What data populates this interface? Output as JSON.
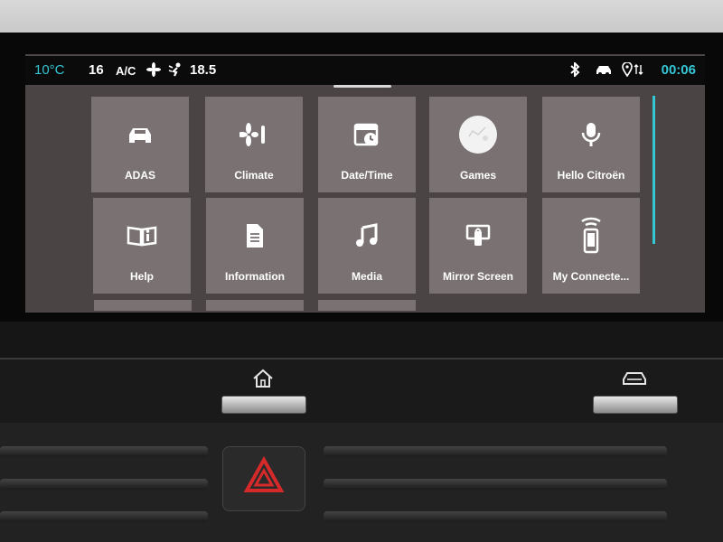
{
  "status": {
    "ext_temp": "10°C",
    "cabin_temp_left": "16",
    "ac": "A/C",
    "cabin_temp_right": "18.5",
    "time": "00:06"
  },
  "apps": [
    {
      "label": "ADAS",
      "icon": "car-icon"
    },
    {
      "label": "Climate",
      "icon": "fan-icon"
    },
    {
      "label": "Date/Time",
      "icon": "calendar-clock-icon"
    },
    {
      "label": "Games",
      "icon": "games-icon"
    },
    {
      "label": "Hello Citroën",
      "icon": "microphone-icon"
    },
    {
      "label": "Help",
      "icon": "book-info-icon"
    },
    {
      "label": "Information",
      "icon": "document-icon"
    },
    {
      "label": "Media",
      "icon": "music-note-icon"
    },
    {
      "label": "Mirror Screen",
      "icon": "mirror-screen-icon"
    },
    {
      "label": "My Connecte...",
      "icon": "connected-phone-icon"
    }
  ],
  "colors": {
    "accent": "#35c6d6",
    "tile": "#7a7272",
    "screen_bg": "#4a4444",
    "hazard": "#d62a2a"
  }
}
